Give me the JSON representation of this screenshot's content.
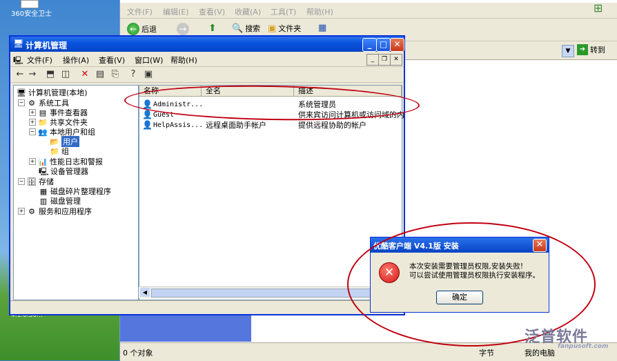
{
  "desktop": {
    "icon_label": "360安全卫士",
    "icon2_label": "4.1.0.50..."
  },
  "explorer": {
    "menu": [
      "文件(F)",
      "编辑(E)",
      "查看(V)",
      "收藏(A)",
      "工具(T)",
      "帮助(H)"
    ],
    "back_label": "后退",
    "search_label": "搜索",
    "folders_label": "文件夹",
    "go_label": "转到",
    "status_left": "0 个对象",
    "status_mid": "字节",
    "status_right": "我的电脑"
  },
  "compmgmt": {
    "title": "计算机管理",
    "menu": [
      "文件(F)",
      "操作(A)",
      "查看(V)",
      "窗口(W)",
      "帮助(H)"
    ],
    "tree": {
      "root": "计算机管理(本地)",
      "system_tools": "系统工具",
      "event_viewer": "事件查看器",
      "shared_folders": "共享文件夹",
      "local_users": "本地用户和组",
      "users": "用户",
      "groups": "组",
      "perf_logs": "性能日志和警报",
      "device_manager": "设备管理器",
      "storage": "存储",
      "defrag": "磁盘碎片整理程序",
      "disk_mgmt": "磁盘管理",
      "services": "服务和应用程序"
    },
    "list": {
      "headers": [
        "名称",
        "全名",
        "描述"
      ],
      "rows": [
        {
          "name": "Administr...",
          "fullname": "",
          "desc": "系统管理员"
        },
        {
          "name": "Guest",
          "fullname": "",
          "desc": "供来宾访问计算机或访问域的内"
        },
        {
          "name": "HelpAssis...",
          "fullname": "远程桌面助手帐户",
          "desc": "提供远程协助的帐户"
        }
      ]
    }
  },
  "dialog": {
    "title": "优酷客户端 V4.1版 安装",
    "line1": "本次安装需要管理员权限,安装失败!",
    "line2": "可以尝试使用管理员权限执行安装程序。",
    "ok_label": "确定",
    "icon_glyph": "✕"
  },
  "watermark": {
    "text": "泛普软件",
    "url": "fanpusoft.com"
  },
  "colors": {
    "highlight_ellipse": "#c00010",
    "titlebar": "#0a55de",
    "selection": "#316ac5"
  }
}
